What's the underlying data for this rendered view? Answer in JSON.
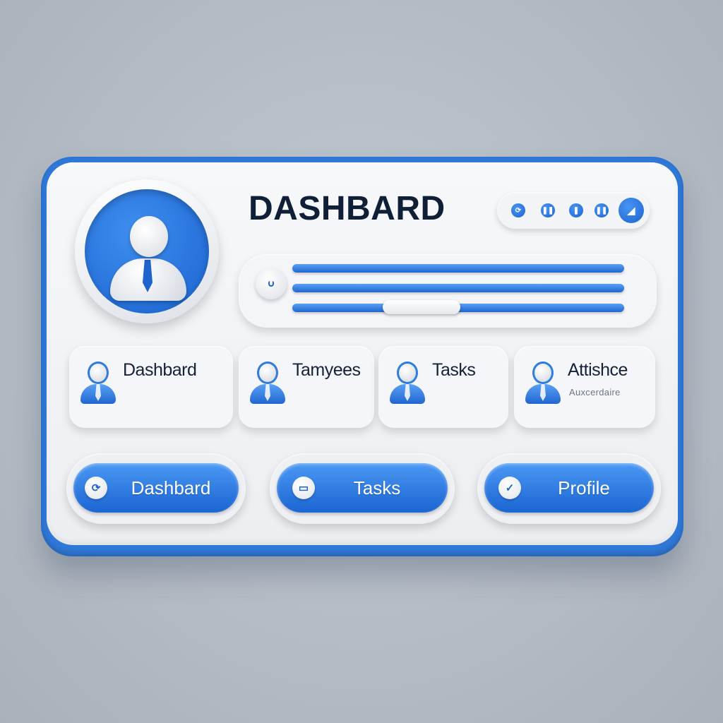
{
  "header": {
    "title": "DASHBARD"
  },
  "toolbar": {
    "icons": [
      "refresh-icon",
      "pause-icon",
      "pause-icon",
      "pause-icon",
      "profile-icon"
    ]
  },
  "cards": [
    {
      "title": "Dashbard",
      "subtitle": "",
      "detail": ""
    },
    {
      "title": "Tamyees",
      "subtitle": "",
      "detail": ""
    },
    {
      "title": "Tasks",
      "subtitle": "",
      "detail": ""
    },
    {
      "title": "Attishce",
      "subtitle": "Auxcerdaire",
      "detail": ""
    }
  ],
  "buttons": [
    {
      "label": "Dashbard",
      "icon": "refresh-icon"
    },
    {
      "label": "Tasks",
      "icon": "tasks-icon"
    },
    {
      "label": "Profile",
      "icon": "check-icon"
    }
  ],
  "colors": {
    "accent": "#1f66cf",
    "accent_light": "#4a98f4",
    "text": "#101f38",
    "background": "#b3b9c1"
  }
}
